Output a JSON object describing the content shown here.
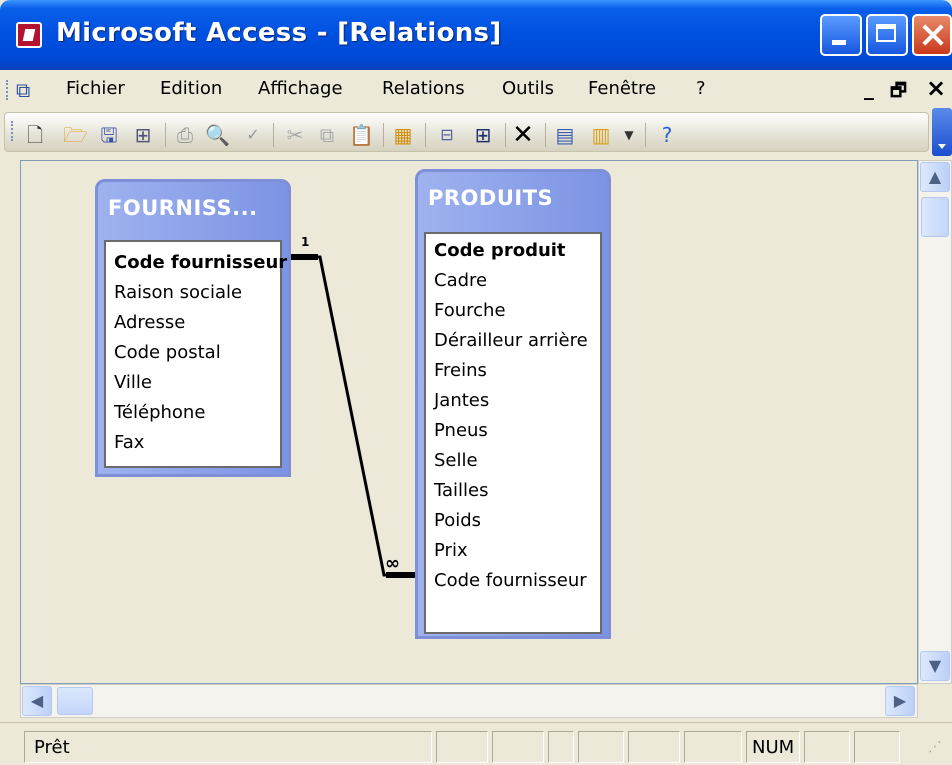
{
  "window": {
    "title": "Microsoft Access - [Relations]",
    "title_icon": "access-key-icon"
  },
  "menu": {
    "items": [
      "Fichier",
      "Edition",
      "Affichage",
      "Relations",
      "Outils",
      "Fenêtre",
      "?"
    ],
    "mdi_minimize": "_",
    "mdi_restore": "🗗",
    "mdi_close": "×"
  },
  "toolbar": {
    "icons": [
      "new-icon",
      "open-icon",
      "save-icon",
      "print-relations-icon",
      "print-icon",
      "print-preview-icon",
      "spelling-icon",
      "cut-icon",
      "copy-icon",
      "paste-icon",
      "show-table-icon",
      "show-direct-icon",
      "show-all-icon",
      "delete-icon",
      "object-icon",
      "new-object-icon",
      "help-icon"
    ]
  },
  "tables": [
    {
      "name": "FOURNISS...",
      "fields": [
        "Code fournisseur",
        "Raison sociale",
        "Adresse",
        "Code postal",
        "Ville",
        "Téléphone",
        "Fax"
      ],
      "primary_key": "Code fournisseur"
    },
    {
      "name": "PRODUITS",
      "fields": [
        "Code produit",
        "Cadre",
        "Fourche",
        "Dérailleur arrière",
        "Freins",
        "Jantes",
        "Pneus",
        "Selle",
        "Tailles",
        "Poids",
        "Prix",
        "Code fournisseur"
      ],
      "primary_key": "Code produit"
    }
  ],
  "relationship": {
    "one_label": "1",
    "many_label": "∞"
  },
  "status": {
    "text": "Prêt",
    "num": "NUM"
  },
  "colors": {
    "titlebar": "#0050e0",
    "table_header": "#8aa0ea",
    "canvas": "#ece9d8"
  }
}
